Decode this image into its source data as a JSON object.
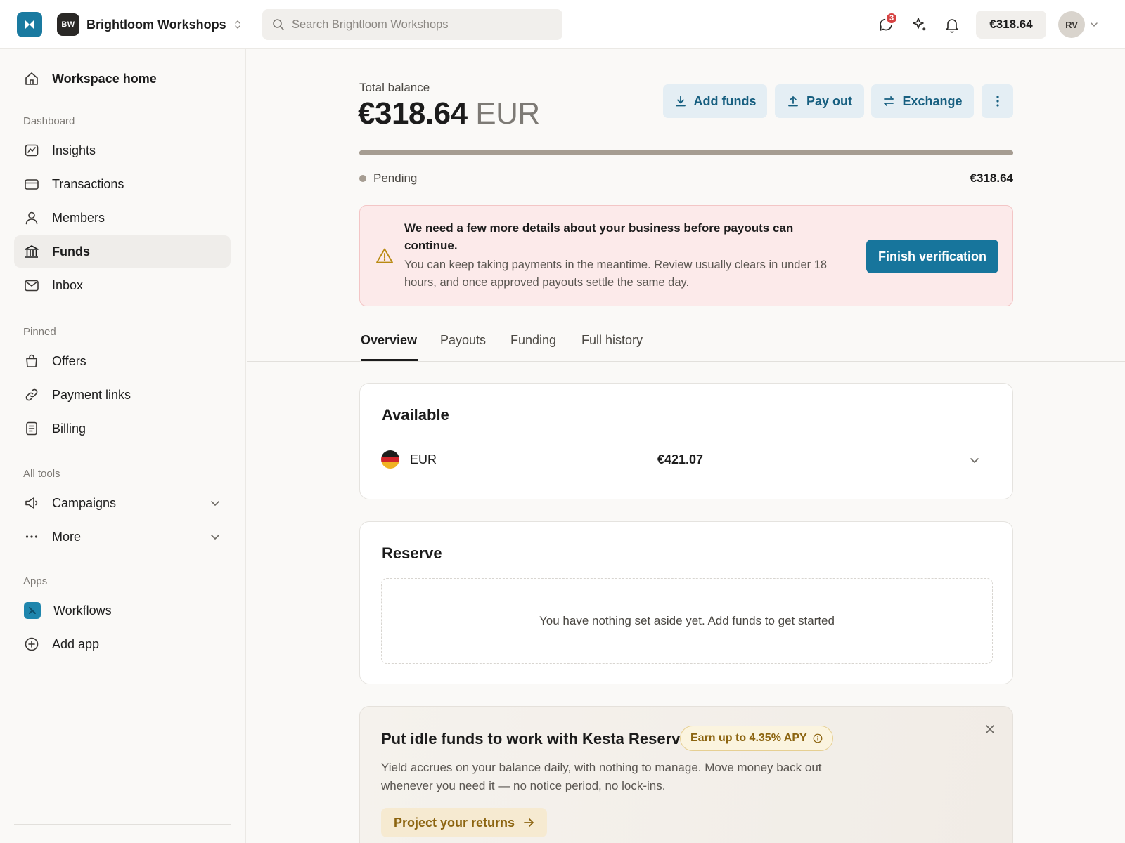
{
  "topbar": {
    "logo_icon": "app-logo-icon",
    "workspace_initials": "BW",
    "workspace_name": "Brightloom Workshops",
    "search_placeholder": "Search Brightloom Workshops",
    "messages_badge": "3",
    "balance": "€318.64",
    "user_initials": "RV"
  },
  "sidebar": {
    "home": "Workspace home",
    "sections": {
      "dashboard": "Dashboard",
      "pinned": "Pinned",
      "all_tools": "All tools",
      "apps": "Apps"
    },
    "dashboard_items": [
      {
        "label": "Insights",
        "icon": "chart-icon"
      },
      {
        "label": "Transactions",
        "icon": "card-icon"
      },
      {
        "label": "Members",
        "icon": "user-icon"
      },
      {
        "label": "Funds",
        "icon": "bank-icon",
        "active": true
      },
      {
        "label": "Inbox",
        "icon": "mail-icon"
      }
    ],
    "pinned_items": [
      {
        "label": "Offers",
        "icon": "bag-icon"
      },
      {
        "label": "Payment links",
        "icon": "link-icon"
      },
      {
        "label": "Billing",
        "icon": "document-icon"
      }
    ],
    "tool_items": [
      {
        "label": "Campaigns",
        "icon": "megaphone-icon"
      },
      {
        "label": "More",
        "icon": "more-icon"
      }
    ],
    "app_items": [
      {
        "label": "Workflows",
        "icon": "workflows-app-icon"
      },
      {
        "label": "Add app",
        "icon": "plus-circle-icon"
      }
    ]
  },
  "balance": {
    "label": "Total balance",
    "amount": "€318.64",
    "currency": "EUR",
    "pending_fraction": 1.0,
    "pending_label": "Pending",
    "pending_amount": "€318.64"
  },
  "actions": {
    "add_funds": "Add funds",
    "pay_out": "Pay out",
    "exchange": "Exchange"
  },
  "alert": {
    "title": "We need a few more details about your business before payouts can continue.",
    "body": "You can keep taking payments in the meantime. Review usually clears in under 18 hours, and once approved payouts settle the same day.",
    "button": "Finish verification"
  },
  "tabs": [
    "Overview",
    "Payouts",
    "Funding",
    "Full history"
  ],
  "available": {
    "title": "Available",
    "currency": "EUR",
    "amount": "€421.07",
    "flag_colors": [
      "#1d1d1b",
      "#d1262c",
      "#f0b323"
    ]
  },
  "reserve": {
    "title": "Reserve",
    "empty": "You have nothing set aside yet. Add funds to get started"
  },
  "promo": {
    "title": "Put idle funds to work with Kesta Reserve",
    "badge": "Earn up to 4.35% APY",
    "body": "Yield accrues on your balance daily, with nothing to manage. Move money back out whenever you need it — no notice period, no lock-ins.",
    "button": "Project your returns"
  },
  "colors": {
    "brand": "#1a7aa0",
    "primary_button": "#17759c",
    "alert_bg": "#fceaea",
    "badge_gold": "#8c6410"
  }
}
